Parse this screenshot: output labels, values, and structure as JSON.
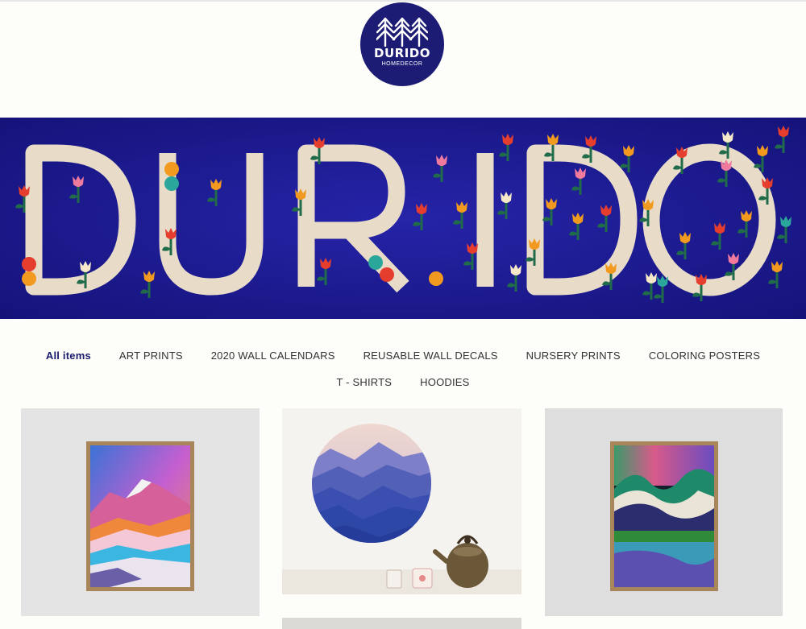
{
  "logo": {
    "name": "DURIDO",
    "subtitle": "HOMEDECOR"
  },
  "nav": {
    "row1": [
      "All items",
      "ART PRINTS",
      "2020 WALL CALENDARS",
      "REUSABLE WALL DECALS",
      "NURSERY PRINTS",
      "COLORING POSTERS"
    ],
    "row2": [
      "T - SHIRTS",
      "HOODIES"
    ],
    "active": "All items"
  },
  "colors": {
    "brand": "#1c1c74",
    "banner_bg": "#1c1a92",
    "letter": "#e8dcc8"
  }
}
